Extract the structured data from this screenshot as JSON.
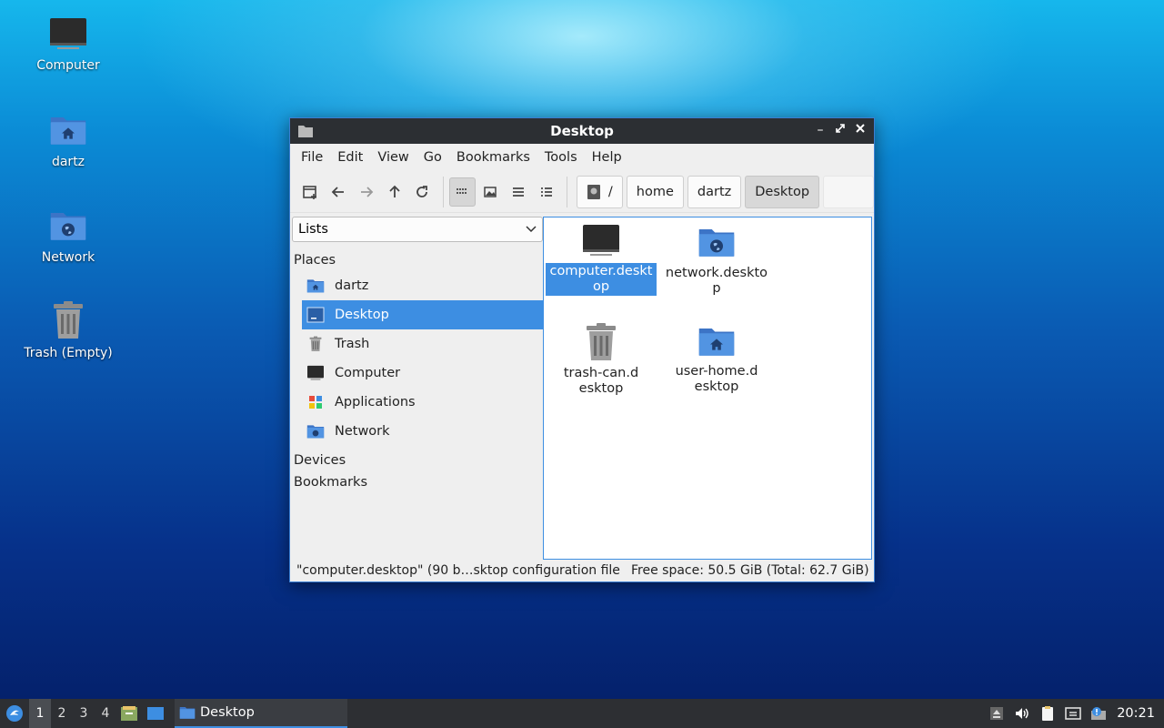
{
  "desktop": {
    "icons": [
      {
        "label": "Computer",
        "icon": "computer-icon"
      },
      {
        "label": "dartz",
        "icon": "home-folder-icon"
      },
      {
        "label": "Network",
        "icon": "network-folder-icon"
      },
      {
        "label": "Trash (Empty)",
        "icon": "trash-icon"
      }
    ]
  },
  "window": {
    "title": "Desktop",
    "menu": [
      "File",
      "Edit",
      "View",
      "Go",
      "Bookmarks",
      "Tools",
      "Help"
    ],
    "toolbar": {
      "buttons": [
        "new-tab-icon",
        "back-icon",
        "forward-icon",
        "up-icon",
        "reload-icon",
        "icon-view-icon",
        "thumbnail-view-icon",
        "compact-view-icon",
        "detailed-list-view-icon"
      ]
    },
    "path": {
      "root": "/",
      "segments": [
        "home",
        "dartz",
        "Desktop"
      ]
    },
    "sidebar": {
      "mode": "Lists",
      "places_header": "Places",
      "places": [
        {
          "label": "dartz",
          "icon": "home-folder-icon"
        },
        {
          "label": "Desktop",
          "icon": "desktop-icon",
          "selected": true
        },
        {
          "label": "Trash",
          "icon": "trash-icon"
        },
        {
          "label": "Computer",
          "icon": "computer-icon"
        },
        {
          "label": "Applications",
          "icon": "applications-icon"
        },
        {
          "label": "Network",
          "icon": "network-folder-icon"
        }
      ],
      "devices_header": "Devices",
      "bookmarks_header": "Bookmarks"
    },
    "files": [
      {
        "name": "computer.desktop",
        "icon": "computer-icon",
        "selected": true
      },
      {
        "name": "network.desktop",
        "icon": "network-folder-icon"
      },
      {
        "name": "trash-can.desktop",
        "icon": "trash-icon"
      },
      {
        "name": "user-home.desktop",
        "icon": "home-folder-icon"
      }
    ],
    "status": {
      "selection": "\"computer.desktop\" (90 b…sktop configuration file",
      "free_space": "Free space: 50.5 GiB (Total: 62.7 GiB)"
    }
  },
  "taskbar": {
    "workspaces": [
      "1",
      "2",
      "3",
      "4"
    ],
    "active_workspace": "1",
    "task_label": "Desktop",
    "clock": "20:21"
  },
  "colors": {
    "accent": "#3d8ee2",
    "titlebar": "#2c2f33",
    "folder_blue": "#4a86d8"
  }
}
